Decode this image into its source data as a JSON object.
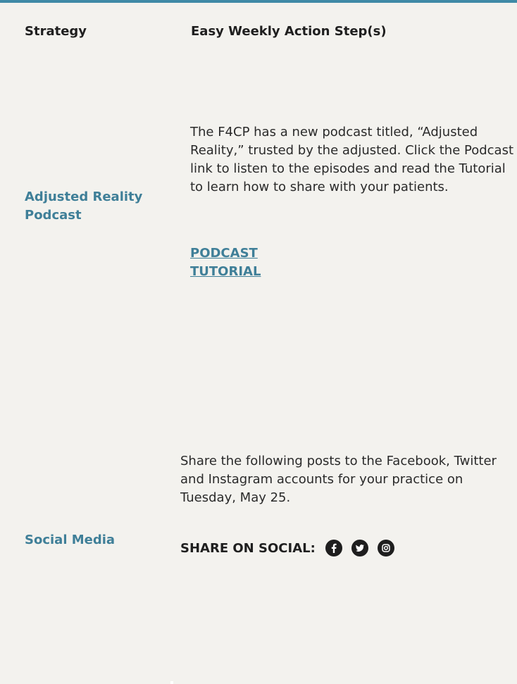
{
  "table": {
    "headers": {
      "strategy": "Strategy",
      "steps": "Easy Weekly Action Step(s)"
    },
    "rows": [
      {
        "strategy": "Adjusted Reality Podcast",
        "text": "The F4CP has a new podcast titled, “Adjusted Reality,” trusted by the adjusted. Click the Podcast link to listen to the episodes and read the Tutorial to learn how to share with your patients.",
        "links": [
          "PODCAST",
          "TUTORIAL"
        ]
      },
      {
        "strategy": "Social Media",
        "text": "Share the following posts to the Facebook, Twitter and Instagram accounts for your practice on Tuesday, May 25.",
        "share_label": "SHARE ON SOCIAL:",
        "social_icons": [
          "facebook-icon",
          "twitter-icon",
          "instagram-icon"
        ]
      }
    ]
  },
  "colors": {
    "accent": "#3f7f98",
    "top_border": "#3f8aa6",
    "cell_bg": "#f3f2ee",
    "grid": "#ffffff"
  }
}
